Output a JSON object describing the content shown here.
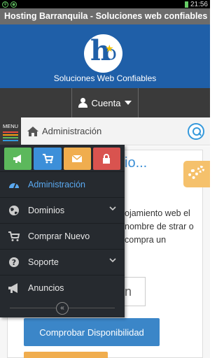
{
  "status_bar": {
    "time": "21:56"
  },
  "window": {
    "title": "Hosting Barranquila - Soluciones web confiables"
  },
  "header": {
    "tagline": "Soluciones Web Confiables"
  },
  "account": {
    "label": "Cuenta"
  },
  "breadcrumb": {
    "menu_label": "MENU",
    "current": "Administración"
  },
  "drawer": {
    "quick_actions": [
      {
        "name": "announcements",
        "icon": "megaphone-icon",
        "color": "#5cb85c"
      },
      {
        "name": "cart",
        "icon": "cart-icon",
        "color": "#3c8fd9"
      },
      {
        "name": "email",
        "icon": "envelope-icon",
        "color": "#f0ad4e"
      },
      {
        "name": "security",
        "icon": "lock-icon",
        "color": "#d9534f"
      }
    ],
    "items": [
      {
        "label": "Administración",
        "icon": "dashboard-icon",
        "active": true
      },
      {
        "label": "Dominios",
        "icon": "globe-icon",
        "has_submenu": true
      },
      {
        "label": "Comprar Nuevo",
        "icon": "cart-icon"
      },
      {
        "label": "Soporte",
        "icon": "question-icon",
        "has_submenu": true
      },
      {
        "label": "Anuncios",
        "icon": "megaphone-icon"
      }
    ],
    "collapse_glyph": "«"
  },
  "main": {
    "title_fragment": "io...",
    "description": "ojamiento web el nombre de strar o compra un",
    "domain_input_fragment": "n",
    "check_button": "Comprobar Disponibilidad"
  }
}
